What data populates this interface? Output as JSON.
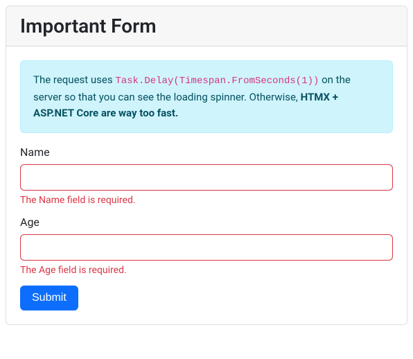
{
  "header": {
    "title": "Important Form"
  },
  "alert": {
    "prefix": "The request uses ",
    "code": "Task.Delay(Timespan.FromSeconds(1))",
    "middle": " on the server so that you can see the loading spinner. Otherwise, ",
    "bold": "HTMX + ASP.NET Core are way too fast."
  },
  "form": {
    "name": {
      "label": "Name",
      "value": "",
      "error": "The Name field is required."
    },
    "age": {
      "label": "Age",
      "value": "",
      "error": "The Age field is required."
    },
    "submit_label": "Submit"
  }
}
